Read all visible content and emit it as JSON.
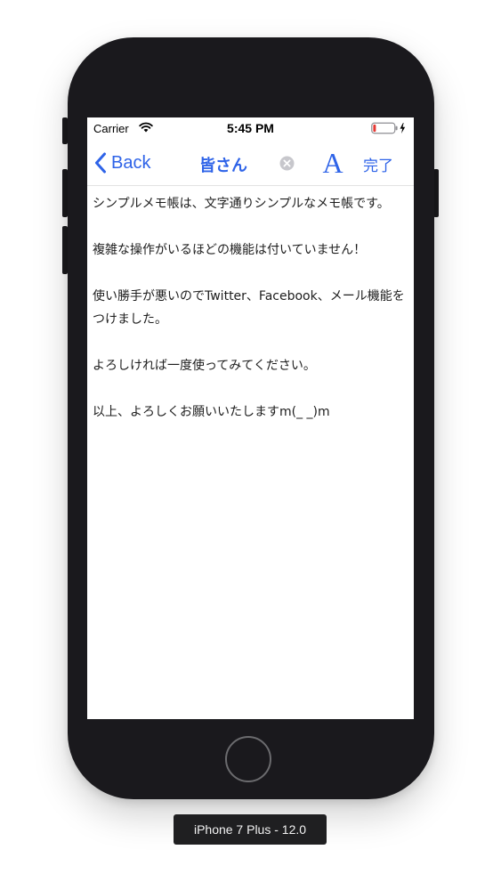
{
  "status_bar": {
    "carrier": "Carrier",
    "time": "5:45 PM",
    "wifi_icon": "wifi-icon",
    "battery_icon": "battery-low-charging-icon",
    "battery_low_color": "#e53935"
  },
  "nav_bar": {
    "back_label": "Back",
    "title": "皆さん",
    "clear_icon": "clear-circle-icon",
    "font_button_label": "A",
    "done_label": "完了",
    "accent_color": "#2e63e8"
  },
  "memo": {
    "paragraphs": [
      "シンプルメモ帳は、文字通りシンプルなメモ帳です。",
      "複雑な操作がいるほどの機能は付いていません！",
      "使い勝手が悪いのでTwitter、Facebook、メール機能をつけました。",
      "よろしければ一度使ってみてください。",
      "以上、よろしくお願いいたしますm(_ _)m"
    ]
  },
  "device": {
    "label": "iPhone 7 Plus - 12.0"
  }
}
